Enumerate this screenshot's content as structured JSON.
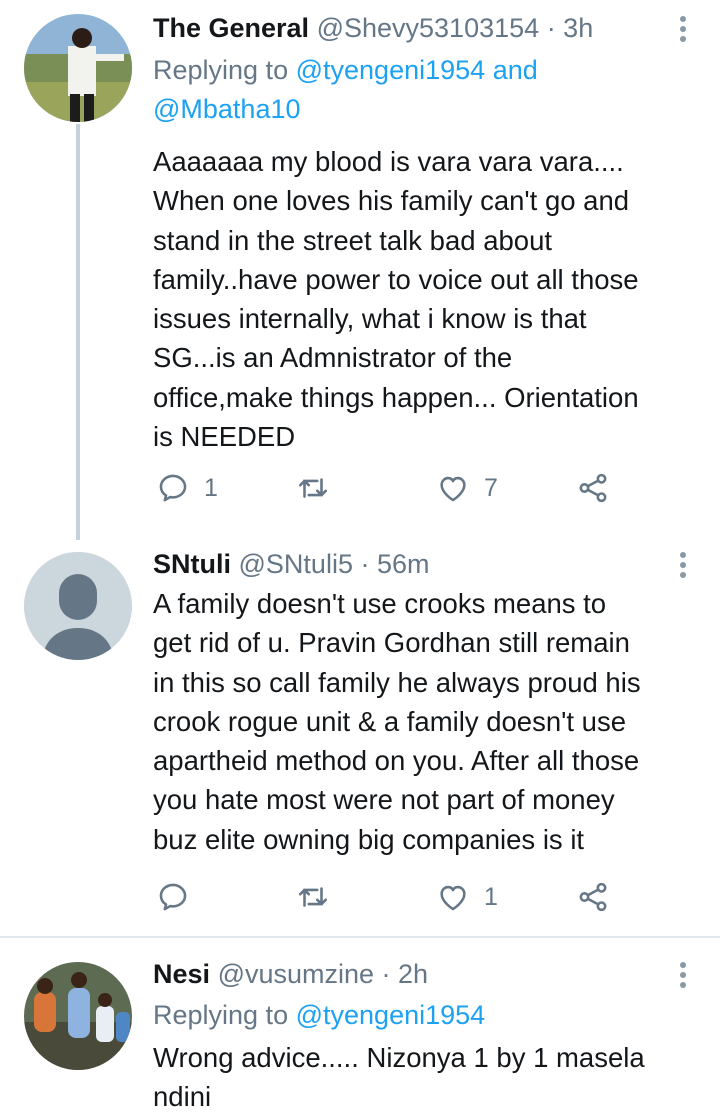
{
  "tweets": [
    {
      "name": "The General",
      "handle": "@Shevy53103154",
      "time": "· 3h",
      "replying_prefix": "Replying to",
      "replying_handle_1": "@tyengeni1954",
      "replying_and": "and",
      "replying_handle_2": "@Mbatha10",
      "lines": [
        "Aaaaaaa my blood is vara vara vara....",
        "When one loves his family can't go and",
        "stand in the street talk bad about",
        "family..have power to voice out all those",
        "issues internally, what i know is that",
        "SG...is an Admnistrator of the",
        "office,make things happen... Orientation",
        "is NEEDED"
      ],
      "reply_count": "1",
      "retweet_count": "",
      "like_count": "7",
      "icons": [
        "reply-icon",
        "retweet-icon",
        "like-icon",
        "share-icon"
      ]
    },
    {
      "name": "SNtuli",
      "handle": "@SNtuli5",
      "time": "· 56m",
      "lines": [
        "A family doesn't use crooks means to",
        "get rid of u. Pravin Gordhan still remain",
        "in this so call family he always proud his",
        "crook rogue unit & a family doesn't use",
        "apartheid method on you. After all those",
        "you hate most were not part of money",
        "buz elite owning big companies is it"
      ],
      "reply_count": "",
      "retweet_count": "",
      "like_count": "1",
      "icons": [
        "reply-icon",
        "retweet-icon",
        "like-icon",
        "share-icon"
      ]
    },
    {
      "name": "Nesi",
      "handle": "@vusumzine",
      "time": "· 2h",
      "replying_prefix": "Replying to",
      "replying_handle_1": "@tyengeni1954",
      "lines": [
        "Wrong advice..... Nizonya 1 by 1 masela",
        "ndini"
      ]
    }
  ],
  "colors": {
    "link": "#1da1f2",
    "secondary_text": "#657786",
    "thread_line": "#c6d1d9",
    "divider": "#e1e8ed"
  }
}
